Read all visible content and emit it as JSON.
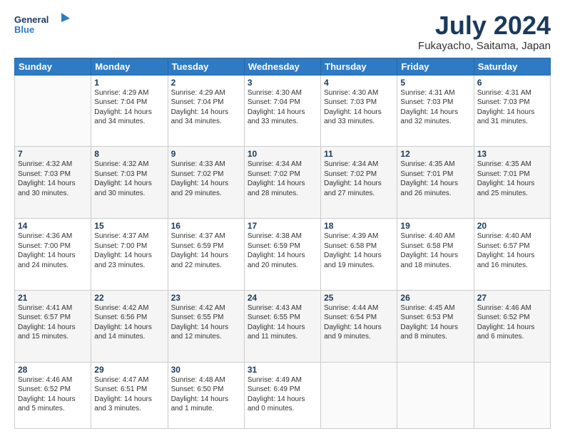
{
  "header": {
    "logo": {
      "line1": "General",
      "line2": "Blue"
    },
    "title": "July 2024",
    "location": "Fukayacho, Saitama, Japan"
  },
  "days_of_week": [
    "Sunday",
    "Monday",
    "Tuesday",
    "Wednesday",
    "Thursday",
    "Friday",
    "Saturday"
  ],
  "weeks": [
    [
      {
        "num": "",
        "info": ""
      },
      {
        "num": "1",
        "info": "Sunrise: 4:29 AM\nSunset: 7:04 PM\nDaylight: 14 hours\nand 34 minutes."
      },
      {
        "num": "2",
        "info": "Sunrise: 4:29 AM\nSunset: 7:04 PM\nDaylight: 14 hours\nand 34 minutes."
      },
      {
        "num": "3",
        "info": "Sunrise: 4:30 AM\nSunset: 7:04 PM\nDaylight: 14 hours\nand 33 minutes."
      },
      {
        "num": "4",
        "info": "Sunrise: 4:30 AM\nSunset: 7:03 PM\nDaylight: 14 hours\nand 33 minutes."
      },
      {
        "num": "5",
        "info": "Sunrise: 4:31 AM\nSunset: 7:03 PM\nDaylight: 14 hours\nand 32 minutes."
      },
      {
        "num": "6",
        "info": "Sunrise: 4:31 AM\nSunset: 7:03 PM\nDaylight: 14 hours\nand 31 minutes."
      }
    ],
    [
      {
        "num": "7",
        "info": "Sunrise: 4:32 AM\nSunset: 7:03 PM\nDaylight: 14 hours\nand 30 minutes."
      },
      {
        "num": "8",
        "info": "Sunrise: 4:32 AM\nSunset: 7:03 PM\nDaylight: 14 hours\nand 30 minutes."
      },
      {
        "num": "9",
        "info": "Sunrise: 4:33 AM\nSunset: 7:02 PM\nDaylight: 14 hours\nand 29 minutes."
      },
      {
        "num": "10",
        "info": "Sunrise: 4:34 AM\nSunset: 7:02 PM\nDaylight: 14 hours\nand 28 minutes."
      },
      {
        "num": "11",
        "info": "Sunrise: 4:34 AM\nSunset: 7:02 PM\nDaylight: 14 hours\nand 27 minutes."
      },
      {
        "num": "12",
        "info": "Sunrise: 4:35 AM\nSunset: 7:01 PM\nDaylight: 14 hours\nand 26 minutes."
      },
      {
        "num": "13",
        "info": "Sunrise: 4:35 AM\nSunset: 7:01 PM\nDaylight: 14 hours\nand 25 minutes."
      }
    ],
    [
      {
        "num": "14",
        "info": "Sunrise: 4:36 AM\nSunset: 7:00 PM\nDaylight: 14 hours\nand 24 minutes."
      },
      {
        "num": "15",
        "info": "Sunrise: 4:37 AM\nSunset: 7:00 PM\nDaylight: 14 hours\nand 23 minutes."
      },
      {
        "num": "16",
        "info": "Sunrise: 4:37 AM\nSunset: 6:59 PM\nDaylight: 14 hours\nand 22 minutes."
      },
      {
        "num": "17",
        "info": "Sunrise: 4:38 AM\nSunset: 6:59 PM\nDaylight: 14 hours\nand 20 minutes."
      },
      {
        "num": "18",
        "info": "Sunrise: 4:39 AM\nSunset: 6:58 PM\nDaylight: 14 hours\nand 19 minutes."
      },
      {
        "num": "19",
        "info": "Sunrise: 4:40 AM\nSunset: 6:58 PM\nDaylight: 14 hours\nand 18 minutes."
      },
      {
        "num": "20",
        "info": "Sunrise: 4:40 AM\nSunset: 6:57 PM\nDaylight: 14 hours\nand 16 minutes."
      }
    ],
    [
      {
        "num": "21",
        "info": "Sunrise: 4:41 AM\nSunset: 6:57 PM\nDaylight: 14 hours\nand 15 minutes."
      },
      {
        "num": "22",
        "info": "Sunrise: 4:42 AM\nSunset: 6:56 PM\nDaylight: 14 hours\nand 14 minutes."
      },
      {
        "num": "23",
        "info": "Sunrise: 4:42 AM\nSunset: 6:55 PM\nDaylight: 14 hours\nand 12 minutes."
      },
      {
        "num": "24",
        "info": "Sunrise: 4:43 AM\nSunset: 6:55 PM\nDaylight: 14 hours\nand 11 minutes."
      },
      {
        "num": "25",
        "info": "Sunrise: 4:44 AM\nSunset: 6:54 PM\nDaylight: 14 hours\nand 9 minutes."
      },
      {
        "num": "26",
        "info": "Sunrise: 4:45 AM\nSunset: 6:53 PM\nDaylight: 14 hours\nand 8 minutes."
      },
      {
        "num": "27",
        "info": "Sunrise: 4:46 AM\nSunset: 6:52 PM\nDaylight: 14 hours\nand 6 minutes."
      }
    ],
    [
      {
        "num": "28",
        "info": "Sunrise: 4:46 AM\nSunset: 6:52 PM\nDaylight: 14 hours\nand 5 minutes."
      },
      {
        "num": "29",
        "info": "Sunrise: 4:47 AM\nSunset: 6:51 PM\nDaylight: 14 hours\nand 3 minutes."
      },
      {
        "num": "30",
        "info": "Sunrise: 4:48 AM\nSunset: 6:50 PM\nDaylight: 14 hours\nand 1 minute."
      },
      {
        "num": "31",
        "info": "Sunrise: 4:49 AM\nSunset: 6:49 PM\nDaylight: 14 hours\nand 0 minutes."
      },
      {
        "num": "",
        "info": ""
      },
      {
        "num": "",
        "info": ""
      },
      {
        "num": "",
        "info": ""
      }
    ]
  ]
}
